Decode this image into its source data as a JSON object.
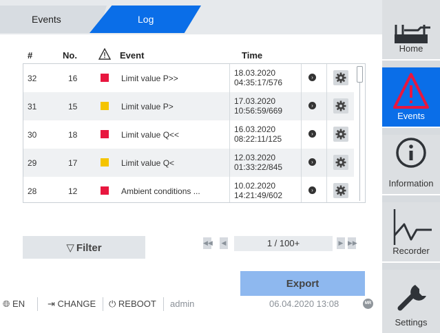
{
  "tabs": [
    {
      "label": "Events",
      "active": false
    },
    {
      "label": "Log",
      "active": true
    }
  ],
  "table": {
    "headers": {
      "index": "#",
      "no": "No.",
      "severity_icon": "warning-icon",
      "event": "Event",
      "time": "Time"
    },
    "rows": [
      {
        "index": "32",
        "no": "16",
        "severity": "red",
        "event": "Limit value P>>",
        "date": "18.03.2020",
        "clock": "04:35:17/576"
      },
      {
        "index": "31",
        "no": "15",
        "severity": "yellow",
        "event": "Limit value P>",
        "date": "17.03.2020",
        "clock": "10:56:59/669"
      },
      {
        "index": "30",
        "no": "18",
        "severity": "red",
        "event": "Limit value Q<<",
        "date": "16.03.2020",
        "clock": "08:22:11/125"
      },
      {
        "index": "29",
        "no": "17",
        "severity": "yellow",
        "event": "Limit value Q<",
        "date": "12.03.2020",
        "clock": "01:33:22/845"
      },
      {
        "index": "28",
        "no": "12",
        "severity": "red",
        "event": "Ambient conditions ...",
        "date": "10.02.2020",
        "clock": "14:21:49/602"
      }
    ]
  },
  "filter_label": "Filter",
  "pager": {
    "text": "1 / 100+"
  },
  "export_label": "Export",
  "status": {
    "language": "EN",
    "change": "CHANGE",
    "reboot": "REBOOT",
    "user": "admin",
    "datetime": "06.04.2020 13:08",
    "badge": "MR"
  },
  "nav": [
    {
      "label": "Home",
      "icon": "home-device-icon",
      "active": false
    },
    {
      "label": "Events",
      "icon": "warning-icon",
      "active": true
    },
    {
      "label": "Information",
      "icon": "info-icon",
      "active": false
    },
    {
      "label": "Recorder",
      "icon": "recorder-icon",
      "active": false
    },
    {
      "label": "Settings",
      "icon": "wrench-icon",
      "active": false
    }
  ],
  "colors": {
    "accent": "#0a6ee8",
    "red": "#e8173f",
    "yellow": "#f5c400",
    "export": "#8eb8ef"
  }
}
